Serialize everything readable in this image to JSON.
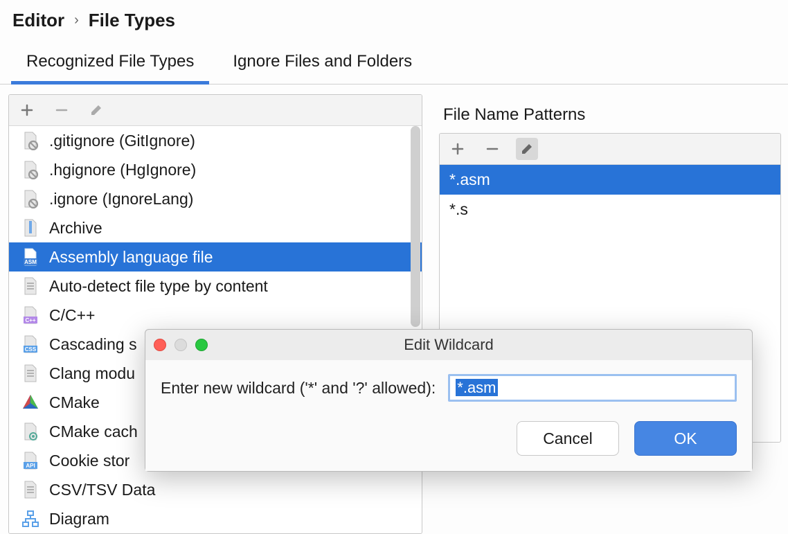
{
  "breadcrumb": {
    "parent": "Editor",
    "current": "File Types"
  },
  "tabs": [
    {
      "label": "Recognized File Types",
      "active": true
    },
    {
      "label": "Ignore Files and Folders",
      "active": false
    }
  ],
  "fileTypes": {
    "items": [
      {
        "icon": "file-blocked",
        "label": ".gitignore (GitIgnore)",
        "selected": false
      },
      {
        "icon": "file-blocked",
        "label": ".hgignore (HgIgnore)",
        "selected": false
      },
      {
        "icon": "file-blocked",
        "label": ".ignore (IgnoreLang)",
        "selected": false
      },
      {
        "icon": "archive",
        "label": "Archive",
        "selected": false
      },
      {
        "icon": "asm",
        "label": "Assembly language file",
        "selected": true
      },
      {
        "icon": "file-text",
        "label": "Auto-detect file type by content",
        "selected": false
      },
      {
        "icon": "cpp",
        "label": "C/C++",
        "selected": false
      },
      {
        "icon": "css",
        "label": "Cascading s",
        "selected": false
      },
      {
        "icon": "file-text",
        "label": "Clang modu",
        "selected": false
      },
      {
        "icon": "cmake",
        "label": "CMake",
        "selected": false
      },
      {
        "icon": "cmake-gear",
        "label": "CMake cach",
        "selected": false
      },
      {
        "icon": "api",
        "label": "Cookie stor",
        "selected": false
      },
      {
        "icon": "file-text",
        "label": "CSV/TSV Data",
        "selected": false
      },
      {
        "icon": "diagram",
        "label": "Diagram",
        "selected": false
      }
    ]
  },
  "patterns": {
    "title": "File Name Patterns",
    "toolbar_highlight": "edit",
    "items": [
      {
        "value": "*.asm",
        "selected": true
      },
      {
        "value": "*.s",
        "selected": false
      }
    ]
  },
  "dialog": {
    "title": "Edit Wildcard",
    "prompt": "Enter new wildcard ('*' and '?' allowed):",
    "input_value": "*.asm",
    "cancel_label": "Cancel",
    "ok_label": "OK"
  }
}
